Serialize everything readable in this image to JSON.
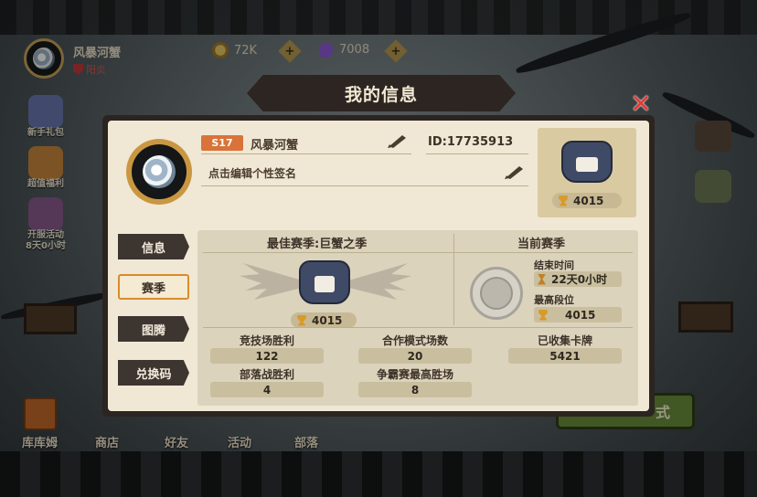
{
  "topbar": {
    "player_name": "风暴河蟹",
    "camp": "阳炎",
    "gold": "72K",
    "gems": "7008"
  },
  "side_menu": [
    {
      "label": "新手礼包",
      "color": "#6a78b0"
    },
    {
      "label": "超值福利",
      "color": "#c9863a"
    },
    {
      "label": "开服活动\n8天0小时",
      "color": "#8a5a8f"
    }
  ],
  "bottom_nav": [
    "库库姆",
    "商店",
    "好友",
    "活动",
    "部落"
  ],
  "modal": {
    "title": "我的信息",
    "close": "✕",
    "profile": {
      "season_tag": "S17",
      "name": "风暴河蟹",
      "id": "ID:17735913",
      "signature": "点击编辑个性签名",
      "rank_score": "4015"
    },
    "tabs": [
      "信息",
      "赛季",
      "图腾",
      "兑换码"
    ],
    "active_tab": 1,
    "best_season": {
      "title": "最佳赛季:巨蟹之季",
      "score": "4015"
    },
    "current_season": {
      "title": "当前赛季",
      "end_time_label": "结束时间",
      "end_time_value": "22天0小时",
      "highest_rank_label": "最高段位",
      "highest_rank_value": "4015"
    },
    "stats": [
      {
        "label": "竞技场胜利",
        "value": "122"
      },
      {
        "label": "合作模式场数",
        "value": "20"
      },
      {
        "label": "已收集卡牌",
        "value": "5421"
      },
      {
        "label": "部落战胜利",
        "value": "4"
      },
      {
        "label": "争霸赛最高胜场",
        "value": "8"
      }
    ]
  },
  "colors": {
    "accent_orange": "#d9733a",
    "tab_active_border": "#d88c2c",
    "close_red": "#e03a36"
  }
}
